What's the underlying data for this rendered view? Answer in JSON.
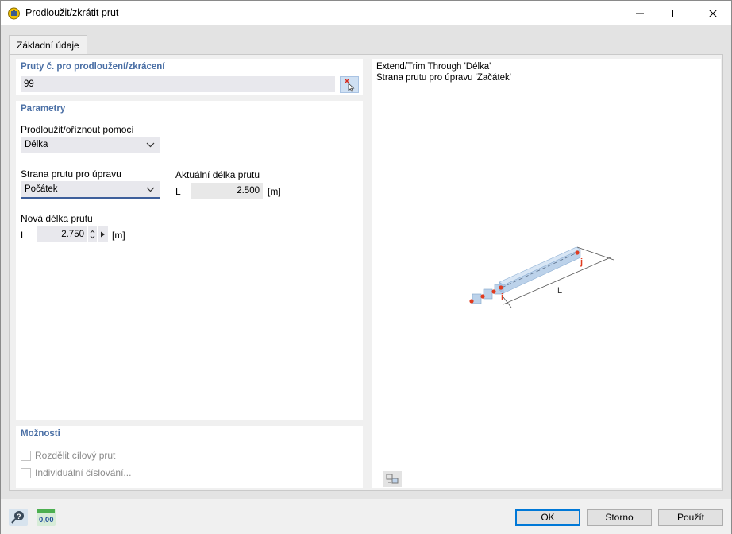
{
  "window": {
    "title": "Prodloužit/zkrátit prut"
  },
  "tabs": [
    {
      "label": "Základní údaje"
    }
  ],
  "members_group": {
    "title": "Pruty č. pro prodloužení/zkrácení",
    "value": "99"
  },
  "parameters": {
    "title": "Parametry",
    "extend_by_label": "Prodloužit/oříznout pomocí",
    "extend_by_value": "Délka",
    "side_label": "Strana prutu pro úpravu",
    "side_value": "Počátek",
    "current_length_label": "Aktuální délka prutu",
    "current_length_symbol": "L",
    "current_length_value": "2.500",
    "current_length_unit": "[m]",
    "new_length_label": "Nová délka prutu",
    "new_length_symbol": "L",
    "new_length_value": "2.750",
    "new_length_unit": "[m]"
  },
  "options": {
    "title": "Možnosti",
    "split_target_label": "Rozdělit cílový prut",
    "individual_numbering_label": "Individuální číslování..."
  },
  "preview": {
    "line1": "Extend/Trim Through 'Délka'",
    "line2": "Strana prutu pro úpravu 'Začátek'",
    "node_i": "i",
    "node_j": "j",
    "dim_label": "L"
  },
  "footer": {
    "ok": "OK",
    "cancel": "Storno",
    "apply": "Použít",
    "units_icon_text": "0,00"
  },
  "colors": {
    "group_title": "#4a6fa5",
    "input_bg": "#e8e8ed",
    "accent": "#0078d7",
    "node": "#e03b1f"
  }
}
